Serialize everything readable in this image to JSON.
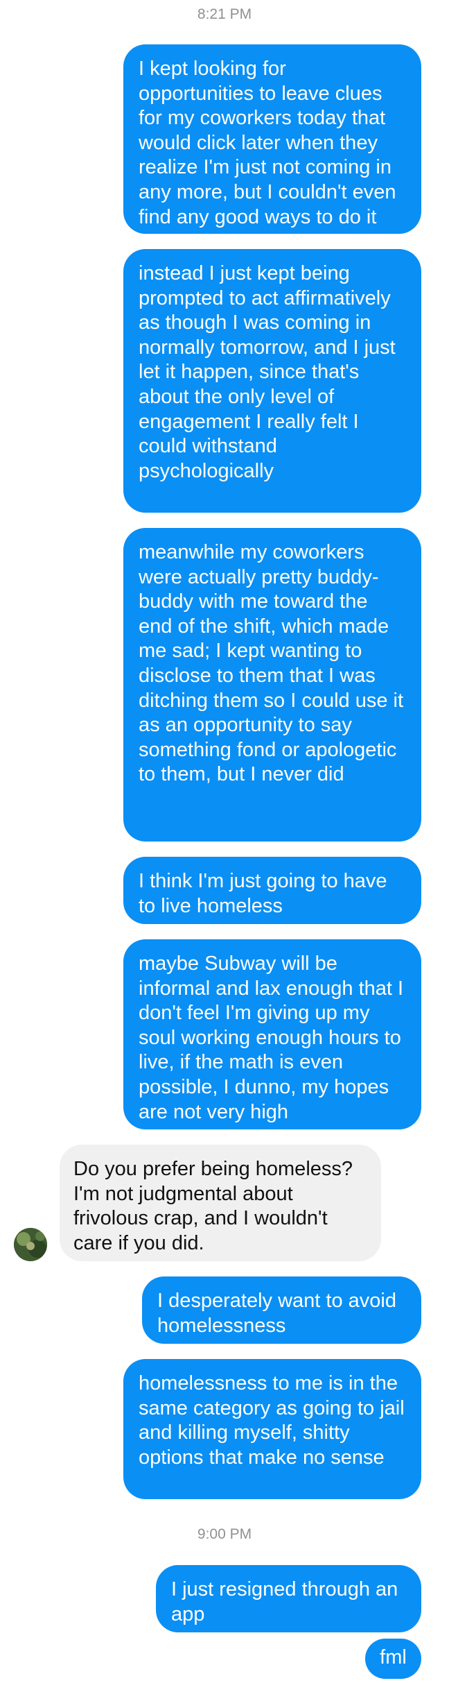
{
  "conversation": {
    "timestamps": [
      "8:21 PM",
      "9:00 PM"
    ],
    "messages": [
      {
        "from": "me",
        "text": "I kept looking for opportunities to leave clues for my coworkers today that would click later when they realize I'm just not coming in any more, but I couldn't even find any good ways to do it"
      },
      {
        "from": "me",
        "text": "instead I just kept being prompted to act affirmatively as though I was coming in normally tomorrow, and I just let it happen, since that's about the only level of engagement I really felt I could withstand psychologically"
      },
      {
        "from": "me",
        "text": "meanwhile my coworkers were actually pretty buddy-buddy with me toward the end of the shift, which made me sad; I kept wanting to disclose to them that I was ditching them so I could use it as an opportunity to say something fond or apologetic to them, but I never did"
      },
      {
        "from": "me",
        "text": "I think I'm just going to have to live homeless"
      },
      {
        "from": "me",
        "text": "maybe Subway will be informal and lax enough that I don't feel I'm giving up my soul working enough hours to live, if the math is even possible, I dunno, my hopes are not very high"
      },
      {
        "from": "them",
        "text": "Do you prefer being homeless? I'm not judgmental about frivolous crap, and I wouldn't care if you did."
      },
      {
        "from": "me",
        "text": "I desperately want to avoid homelessness"
      },
      {
        "from": "me",
        "text": "homelessness to me is in the same category as going to jail and killing myself, shitty options that make no sense"
      },
      {
        "from": "me",
        "text": "I just resigned through an app"
      },
      {
        "from": "me",
        "text": "fml"
      }
    ]
  },
  "colors": {
    "outgoing_bubble": "#0a8ff5",
    "incoming_bubble": "#f0f0f0",
    "timestamp": "#8f9193"
  }
}
